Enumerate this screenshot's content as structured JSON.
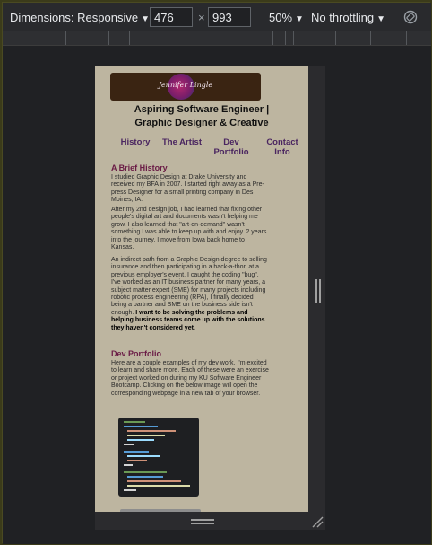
{
  "toolbar": {
    "dimensions_label": "Dimensions: Responsive",
    "width_value": "476",
    "times_symbol": "×",
    "height_value": "993",
    "zoom_label": "50%",
    "throttle_label": "No throttling"
  },
  "page": {
    "logo_text": "Jennifer Lingle",
    "tagline_line1": "Aspiring Software Engineer |",
    "tagline_line2": "Graphic Designer & Creative",
    "nav": [
      {
        "label": "History"
      },
      {
        "label": "The Artist"
      },
      {
        "label": "Dev Portfolio"
      },
      {
        "label": "Contact Info"
      }
    ],
    "history": {
      "title": "A Brief History",
      "p1": "I studied Graphic Design at Drake University and received my BFA in 2007. I started right away as a Pre-press Designer for a small printing company in Des Moines, IA.",
      "p2": "After my 2nd design job, I had learned that fixing other people's digital art and documents wasn't helping me grow. I also learned that \"art-on-demand\" wasn't something I was able to keep up with and enjoy. 2 years into the journey, I move from Iowa back home to Kansas.",
      "p3": "An indirect path from a Graphic Design degree to selling insurance and then participating in a hack-a-thon at a previous employer's event, I caught the coding \"bug\". I've worked as an IT business partner for many years, a subject matter expert (SME) for many projects including robotic process engineering (RPA), I finally decided being a partner and SME on the business side isn't enough.",
      "p3_bold": "I want to be solving the problems and helping business teams come up with the solutions they haven't considered yet."
    },
    "portfolio": {
      "title": "Dev Portfolio",
      "p1": "Here are a couple examples of my dev work. I'm excited to learn and share more. Each of these were an exercise or project worked on during my KU Software Engineer Bootcamp. Clicking on the below image will open the corresponding webpage in a new tab of your browser."
    }
  },
  "icons": {
    "rotate": "rotate-icon",
    "dropdown": "caret-down-icon",
    "resize_corner": "resize-corner-icon"
  },
  "colors": {
    "page_background": "#bdb5a0",
    "section_title": "#6a1b45",
    "nav_link": "#4a2560",
    "logo_background": "#3a2412"
  }
}
